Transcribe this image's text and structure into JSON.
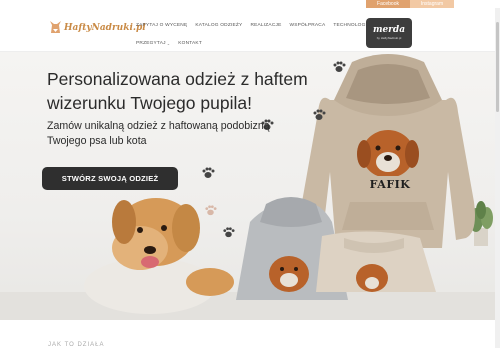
{
  "topbar": {
    "facebook_label": "Facebook",
    "instagram_label": "Instagram"
  },
  "header": {
    "logo_text": "HaftyNadruki.pl",
    "nav_row1": [
      {
        "label": "ZAPYTAJ O WYCENĘ",
        "has_dropdown": false
      },
      {
        "label": "KATALOG ODZIEŻY",
        "has_dropdown": false
      },
      {
        "label": "REALIZACJE",
        "has_dropdown": false
      },
      {
        "label": "WSPÓŁPRACA",
        "has_dropdown": false
      },
      {
        "label": "TECHNOLOGIE",
        "has_dropdown": true
      }
    ],
    "nav_row2": [
      {
        "label": "PRZEGYTAJ",
        "has_dropdown": true
      },
      {
        "label": "KONTAKT",
        "has_dropdown": false
      }
    ],
    "merda_badge": {
      "title": "merda",
      "subtitle": "by HaftyNadruki.pl"
    }
  },
  "hero": {
    "title": "Personalizowana odzież z haftem wizerunku Twojego pupila!",
    "subtitle": "Zamów unikalną odzież z haftowaną podobizną Twojego psa lub kota",
    "cta_label": "STWÓRZ SWOJĄ ODZIEŻ",
    "hoodie_name": "FAFIK"
  },
  "below": {
    "section_heading": "JAK TO DZIAŁA"
  },
  "colors": {
    "accent": "#c98a45",
    "dark": "#2f2f2f",
    "hero_bg": "#f2f1ef",
    "hoodie_beige": "#c8b8a3",
    "hoodie_grey": "#b9bcbf"
  }
}
